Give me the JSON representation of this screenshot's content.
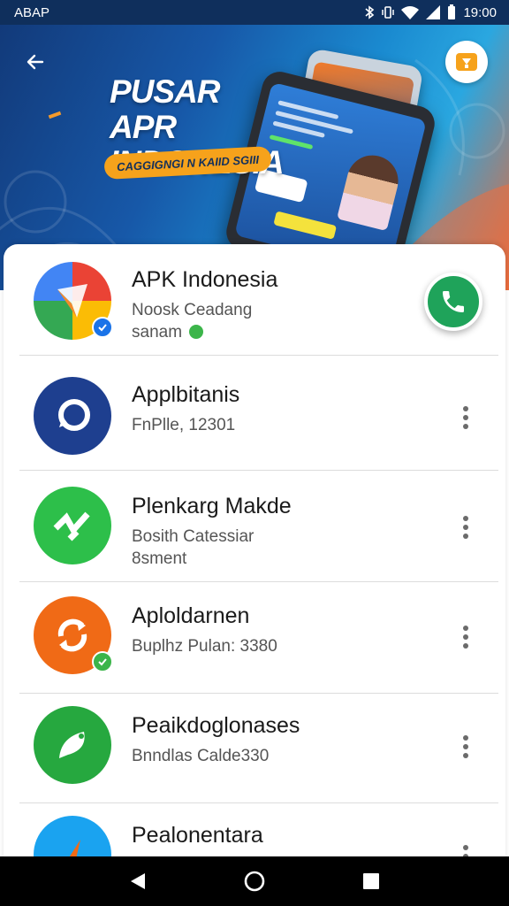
{
  "status_bar": {
    "left_text": "ABAP",
    "time": "19:00"
  },
  "hero": {
    "title_line1": "PUSAR APR",
    "title_line2": "INDONESIA",
    "pill_text": "CAGGIGNGI N KAIID SGIII"
  },
  "apps": [
    {
      "name": "APK Indonesia",
      "sub1": "Noosk Ceadang",
      "sub2": "sanam",
      "icon": "multicolor-app-icon",
      "color": "#ea4335",
      "badge": true,
      "badge_color": "#1a73e8",
      "action": "call-button"
    },
    {
      "name": "Applbitanis",
      "sub1": "FnPlle, 12301",
      "sub2": "",
      "icon": "chat-bubble-icon",
      "color": "#1e3f8f",
      "badge": false,
      "action": "more-menu"
    },
    {
      "name": "Plenkarg Makde",
      "sub1": "Bosith Catessiar",
      "sub2": "8sment",
      "icon": "lightning-zigzag-icon",
      "color": "#2dbf4a",
      "badge": false,
      "action": "more-menu"
    },
    {
      "name": "Aploldarnen",
      "sub1": "Buplhz Pulan: 3380",
      "sub2": "",
      "icon": "refresh-arrows-icon",
      "color": "#f06a16",
      "badge": true,
      "badge_color": "#3cb54a",
      "action": "more-menu"
    },
    {
      "name": "Peaikdoglonases",
      "sub1": "Bnndlas Calde330",
      "sub2": "",
      "icon": "leaf-chat-icon",
      "color": "#26a83f",
      "badge": false,
      "action": "more-menu"
    },
    {
      "name": "Pealonentara",
      "sub1": "",
      "sub2": "",
      "icon": "compass-icon",
      "color": "#1aa3f0",
      "badge": false,
      "action": "more-menu"
    }
  ],
  "nav": {
    "back": "back-nav-icon",
    "home": "home-nav-icon",
    "recents": "recents-nav-icon"
  },
  "colors": {
    "status_bar": "#0f2f5c",
    "call_button": "#1fa35a",
    "pill": "#f6a21b"
  }
}
